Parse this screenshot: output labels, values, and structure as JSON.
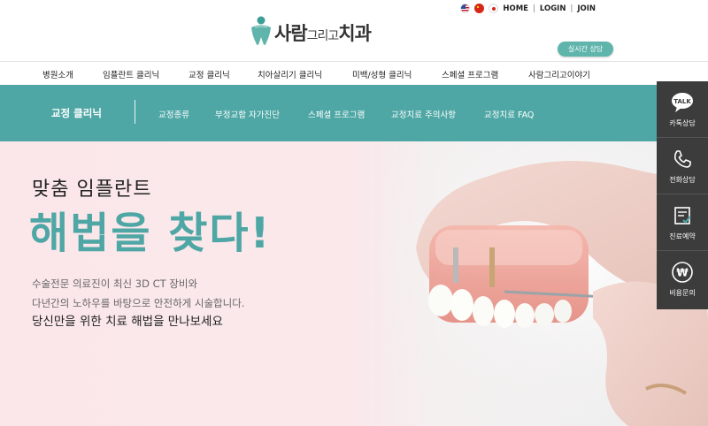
{
  "header": {
    "logo": {
      "text_main": "사람",
      "text_mid": "그리고",
      "text_end": "치과"
    },
    "util_links": [
      "HOME",
      "LOGIN",
      "JOIN"
    ],
    "languages": [
      "us-flag-icon",
      "cn-flag-icon",
      "jp-flag-icon"
    ],
    "consult_button": "실시간 상담"
  },
  "gnb": {
    "items": [
      "병원소개",
      "임플란트 클리닉",
      "교정 클리닉",
      "치아살리기 클리닉",
      "미백/성형 클리닉",
      "스페셜 프로그램",
      "사람그리고이야기"
    ]
  },
  "subnav": {
    "title": "교정 클리닉",
    "items": [
      "교정종류",
      "부정교합 자가진단",
      "스페셜 프로그램",
      "교정치료 주의사항",
      "교정치료 FAQ"
    ]
  },
  "hero": {
    "subtitle": "맞춤 임플란트",
    "title": "해법을 찾다!",
    "desc_line1": "수술전문 의료진이 최신 3D CT 장비와",
    "desc_line2": "다년간의 노하우를 바탕으로 안전하게 시술합니다.",
    "desc_line3": "당신만을 위한 치료 해법을 만나보세요"
  },
  "quick_menu": {
    "items": [
      {
        "label": "카톡상담",
        "icon": "talk-icon",
        "icon_text": "TALK"
      },
      {
        "label": "전화상담",
        "icon": "phone-icon"
      },
      {
        "label": "진료예약",
        "icon": "calendar-icon"
      },
      {
        "label": "비용문의",
        "icon": "won-icon",
        "icon_text": "₩"
      }
    ]
  },
  "colors": {
    "accent": "#4ea7a5",
    "quick_bg": "#3c3c3c",
    "hero_bg": "#fbe7ea"
  }
}
